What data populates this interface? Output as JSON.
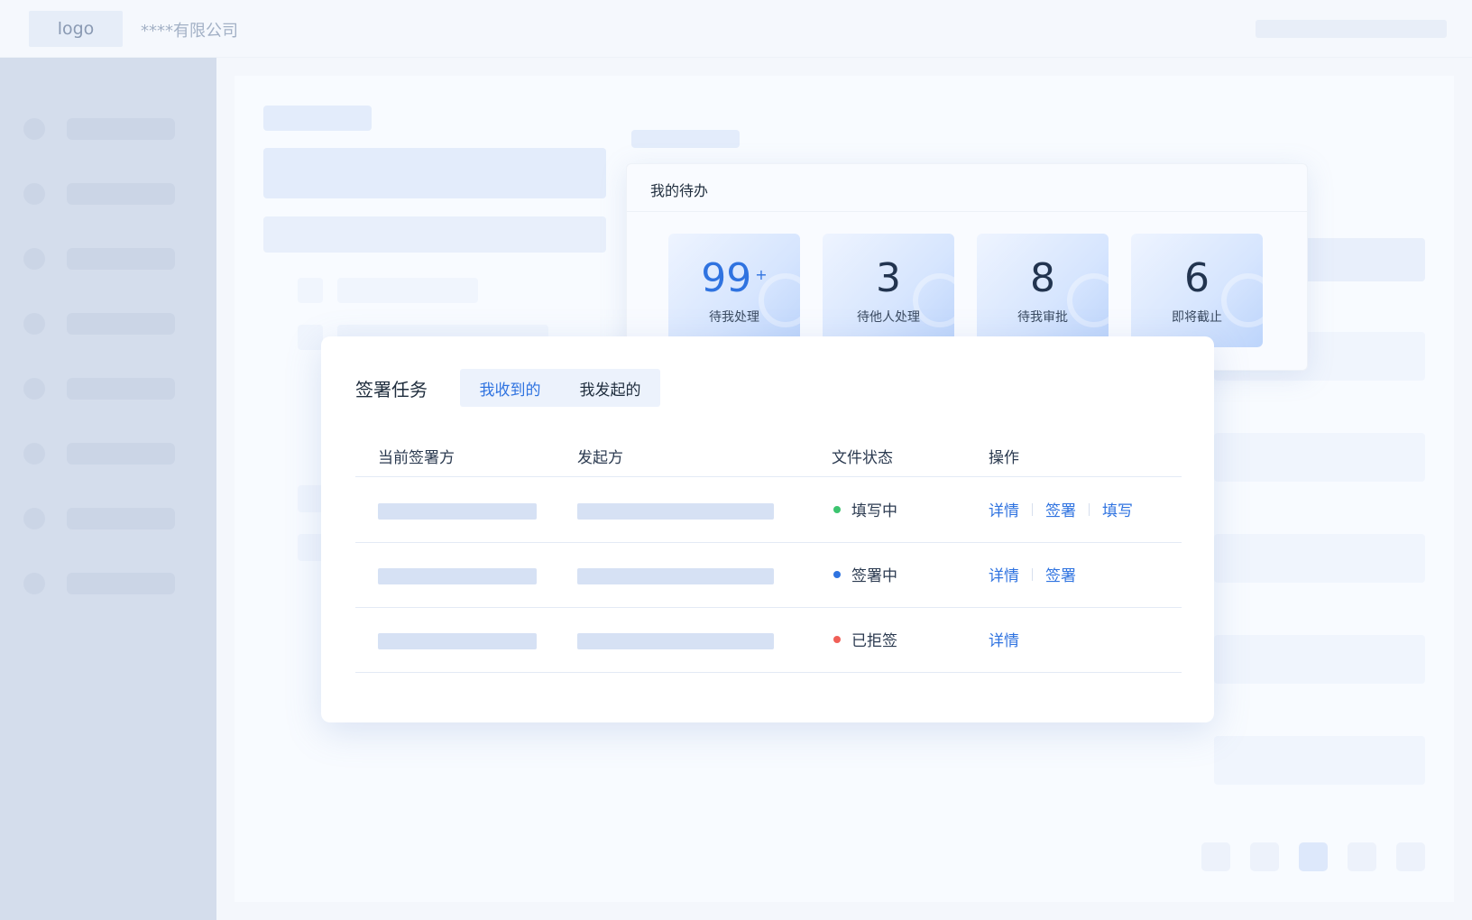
{
  "header": {
    "logo": "logo",
    "company": "****有限公司"
  },
  "todo": {
    "title": "我的待办",
    "stats": [
      {
        "value": "99",
        "suffix": "+",
        "label": "待我处理"
      },
      {
        "value": "3",
        "suffix": "",
        "label": "待他人处理"
      },
      {
        "value": "8",
        "suffix": "",
        "label": "待我审批"
      },
      {
        "value": "6",
        "suffix": "",
        "label": "即将截止"
      }
    ]
  },
  "tasks": {
    "title": "签署任务",
    "tabs": [
      {
        "label": "我收到的",
        "active": true
      },
      {
        "label": "我发起的",
        "active": false
      }
    ],
    "columns": [
      "当前签署方",
      "发起方",
      "文件状态",
      "操作"
    ],
    "rows": [
      {
        "status": "填写中",
        "status_color": "#3cc46f",
        "actions": [
          "详情",
          "签署",
          "填写"
        ]
      },
      {
        "status": "签署中",
        "status_color": "#2f73e0",
        "actions": [
          "详情",
          "签署"
        ]
      },
      {
        "status": "已拒签",
        "status_color": "#f05f57",
        "actions": [
          "详情"
        ]
      }
    ]
  },
  "colors": {
    "accent": "#2f73e0",
    "sidebar": "#d4ddec"
  }
}
